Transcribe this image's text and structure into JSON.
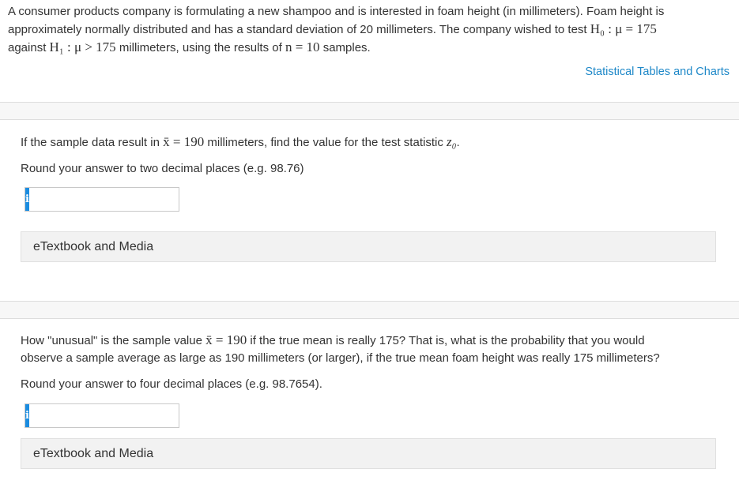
{
  "intro": {
    "line1": "A consumer products company is formulating a new shampoo and is interested in foam height (in millimeters). Foam height is",
    "line2_a": "approximately normally distributed and has a standard deviation of 20 millimeters. The company wished to test ",
    "line2_math": "H₀ : μ = 175",
    "line3_a": "against ",
    "line3_math1": "H₁ : μ > 175",
    "line3_b": " millimeters, using the results of ",
    "line3_math2": "n = 10",
    "line3_c": " samples."
  },
  "tables_link": "Statistical Tables and Charts",
  "q1": {
    "text_a": "If the sample data result in ",
    "math": "x̄ = 190",
    "text_b": " millimeters, find the value for the test statistic ",
    "math2": "z₀",
    "text_c": ".",
    "round": "Round your answer to two decimal places (e.g. 98.76)",
    "answer_value": "",
    "info_icon": "i",
    "etext": "eTextbook and Media"
  },
  "q2": {
    "text_a": "How \"unusual\" is the sample value ",
    "math": "x̄ = 190",
    "text_b": " if the true mean is really 175? That is, what is the probability that you would",
    "line2": "observe a sample average as large as 190 millimeters (or larger), if the true mean foam height was really 175 millimeters?",
    "round": "Round your answer to four decimal places (e.g. 98.7654).",
    "answer_value": "",
    "info_icon": "i",
    "etext": "eTextbook and Media"
  },
  "colors": {
    "link": "#1e88c8",
    "info": "#1a8ce0"
  }
}
